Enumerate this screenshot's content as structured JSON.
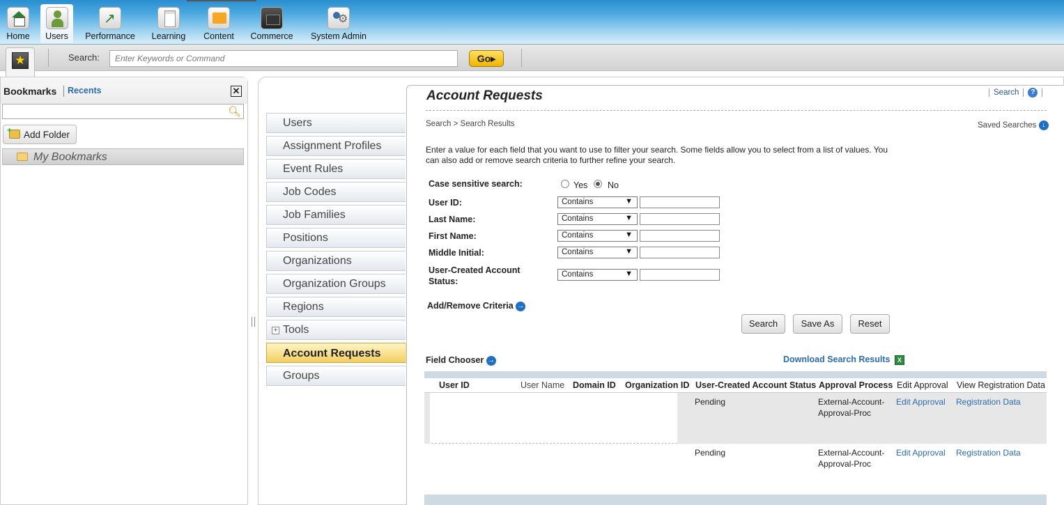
{
  "nav": {
    "items": [
      {
        "label": "Home",
        "icon": "home-icon"
      },
      {
        "label": "Users",
        "icon": "users-icon",
        "active": true
      },
      {
        "label": "Performance",
        "icon": "performance-icon"
      },
      {
        "label": "Learning",
        "icon": "learning-icon"
      },
      {
        "label": "Content",
        "icon": "content-icon"
      },
      {
        "label": "Commerce",
        "icon": "commerce-icon"
      },
      {
        "label": "System Admin",
        "icon": "system-admin-icon"
      }
    ]
  },
  "searchbar": {
    "label": "Search:",
    "placeholder": "Enter Keywords or Command",
    "go_label": "Go▸"
  },
  "bookmarks": {
    "title": "Bookmarks",
    "recents": "Recents",
    "close": "✕",
    "add_folder": "Add Folder",
    "my_bookmarks": "My Bookmarks"
  },
  "menu": {
    "items": [
      {
        "label": "Users"
      },
      {
        "label": "Assignment Profiles"
      },
      {
        "label": "Event Rules"
      },
      {
        "label": "Job Codes"
      },
      {
        "label": "Job Families"
      },
      {
        "label": "Positions"
      },
      {
        "label": "Organizations"
      },
      {
        "label": "Organization Groups"
      },
      {
        "label": "Regions"
      },
      {
        "label": "Tools"
      },
      {
        "label": "Account Requests"
      },
      {
        "label": "Groups"
      }
    ]
  },
  "page": {
    "title": "Account Requests",
    "search_link": "Search",
    "help": "?",
    "breadcrumb": "Search > Search Results",
    "saved_searches": "Saved Searches",
    "instructions": "Enter a value for each field that you want to use to filter your search. Some fields allow you to select from a list of values. You can also add or remove search criteria to further refine your search."
  },
  "form": {
    "case_sensitive": {
      "label": "Case sensitive search:",
      "yes": "Yes",
      "no": "No",
      "selected": "No"
    },
    "fields": [
      {
        "label": "User ID:",
        "operator": "Contains",
        "value": ""
      },
      {
        "label": "Last Name:",
        "operator": "Contains",
        "value": ""
      },
      {
        "label": "First Name:",
        "operator": "Contains",
        "value": ""
      },
      {
        "label": "Middle Initial:",
        "operator": "Contains",
        "value": ""
      },
      {
        "label": "User-Created Account Status:",
        "operator": "Contains",
        "value": ""
      }
    ],
    "add_remove": "Add/Remove Criteria",
    "buttons": {
      "search": "Search",
      "save_as": "Save As",
      "reset": "Reset"
    }
  },
  "results": {
    "field_chooser": "Field Chooser",
    "download": "Download Search Results",
    "columns": [
      "User ID",
      "User Name",
      "Domain ID",
      "Organization ID",
      "User-Created Account Status",
      "Approval Process",
      "Edit Approval",
      "View Registration Data"
    ],
    "rows": [
      {
        "status": "Pending",
        "process_line1": "External-Account-",
        "process_line2": "Approval-Proc",
        "edit": "Edit Approval",
        "reg": "Registration Data"
      },
      {
        "status": "Pending",
        "process_line1": "External-Account-",
        "process_line2": "Approval-Proc",
        "edit": "Edit Approval",
        "reg": "Registration Data"
      }
    ]
  }
}
